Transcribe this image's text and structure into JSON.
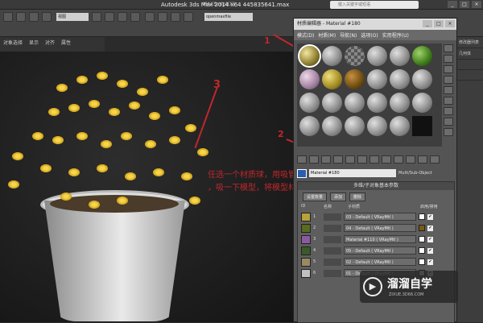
{
  "app": {
    "title": "Autodesk 3ds Max  2014 x64      445835641.max",
    "menu": [
      " ",
      " ",
      " ",
      " ",
      " ",
      " "
    ],
    "maxscript": "MAXScript(X)",
    "search_placeholder": "键入关键字或短语",
    "win_buttons": [
      "_",
      "□",
      "×"
    ]
  },
  "toolbar": {
    "selection_filter": "视图",
    "named_selection": "openmaxfile"
  },
  "left_menu": [
    "对象选择",
    "显示",
    "对齐",
    "属性"
  ],
  "material_editor": {
    "title": "材质编辑器 - Material #180",
    "menu": [
      "模式(D)",
      "材质(M)",
      "导航(N)",
      "选项(O)",
      "实用程序(U)"
    ],
    "material_name": "Material #180",
    "material_type": "Multi/Sub-Object",
    "rollout_title": "多维/子对象基本参数",
    "buttons": [
      "设置数量",
      "添加",
      "删除"
    ],
    "column_headers": [
      "ID",
      "名称",
      "子材质",
      "启用/禁用"
    ],
    "rows": [
      {
        "id": "1",
        "submaterial": "03 - Default  ( VRayMtl )",
        "swatch": "#b7a23a"
      },
      {
        "id": "2",
        "submaterial": "04 - Default  ( VRayMtl )",
        "swatch": "#5a6a20"
      },
      {
        "id": "3",
        "submaterial": "Material #110  ( VRayMtl )",
        "swatch": "#8a5aa0"
      },
      {
        "id": "4",
        "submaterial": "05 - Default  ( VRayMtl )",
        "swatch": "#3a5a2a"
      },
      {
        "id": "5",
        "submaterial": "02 - Default  ( VRayMtl )",
        "swatch": "#9a8a60"
      },
      {
        "id": "6",
        "submaterial": "01 - Default  ( VRayMtl )",
        "swatch": "#c0c0c0"
      }
    ],
    "chip_colors": [
      "#ffffff",
      "#7a5a10",
      "#ffffff",
      "#ffffff",
      "#ffffff",
      "#ffffff"
    ]
  },
  "annotations": {
    "label_1": "1",
    "label_2": "2",
    "label_3": "3",
    "note_line1": "任选一个材质球，用吸管工具吸",
    "note_line2": "，吸一下模型，将模型材质吸到材质球中"
  },
  "right_panel": [
    "修改器列表",
    "几何体",
    " ",
    " "
  ],
  "watermark": {
    "logo_glyph": "▶",
    "text": "溜溜自学",
    "url": "ZIXUE.3D66.COM"
  }
}
